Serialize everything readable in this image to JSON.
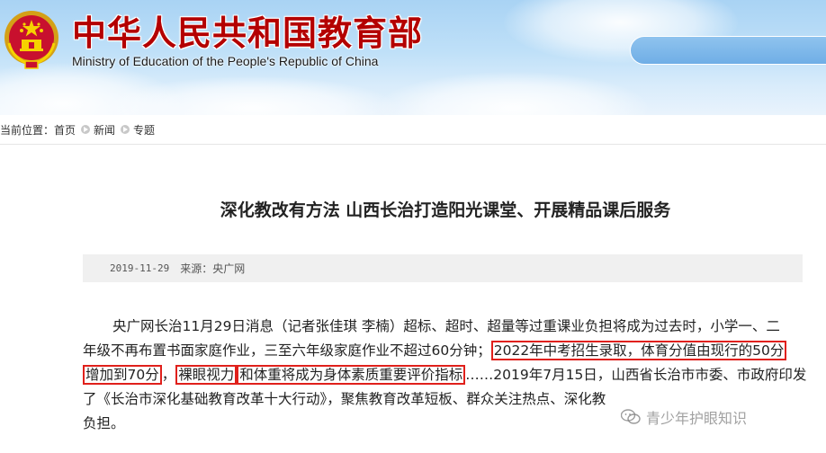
{
  "header": {
    "title_cn": "中华人民共和国教育部",
    "title_en": "Ministry of Education of the People's Republic of China",
    "emblem_icon": "national-emblem-icon",
    "brand_red": "#b40000"
  },
  "breadcrumb": {
    "label": "当前位置：",
    "items": [
      "首页",
      "新闻",
      "专题"
    ],
    "separator_icon": "chevron-right-circle-icon"
  },
  "article": {
    "title": "深化教改有方法 山西长治打造阳光课堂、开展精品课后服务",
    "date": "2019-11-29",
    "source": "来源：央广网",
    "lines": {
      "l1": "央广网长治11月29日消息（记者张佳琪 李楠）超标、超时、超量等过重课业负担将成为过去时，小学一、二",
      "l2a": "年级不再布置书面家庭作业，三至六年级家庭作业不超过60分钟；",
      "l2b": "2022年中考招生录取，体育分值由现行的50分",
      "l3a": "增加到70分",
      "l3b": "，",
      "l3c": "裸眼视力",
      "l3d": "和体重将成为身体素质重要评价指标",
      "l3e": "……2019年7月15日，山西省长治市市委、市政府印发",
      "l4": "了《长治市深化基础教育改革十大行动》，聚焦教育改革短板、群众关注热点、深化教",
      "l5": "负担。"
    },
    "highlight_color": "#e0201b"
  },
  "watermark": {
    "text": "青少年护眼知识",
    "icon": "wechat-icon"
  }
}
